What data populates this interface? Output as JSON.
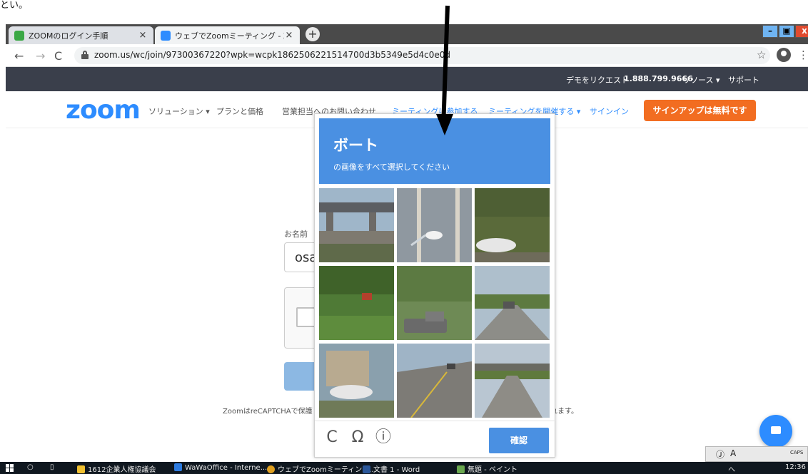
{
  "top_note": "とい。",
  "browser": {
    "tabs": [
      {
        "title": "ZOOMのログイン手順",
        "favicon_color": "#3aa845",
        "close": "×"
      },
      {
        "title": "ウェブでZoomミーティング - Zoom",
        "favicon_color": "#2d8cff",
        "close": "×"
      }
    ],
    "new_tab": "+",
    "window": {
      "minimize": "–",
      "maximize": "▣",
      "close": "x"
    },
    "nav": {
      "back": "←",
      "forward": "→",
      "reload": "C"
    },
    "url": "zoom.us/wc/join/97300367220?wpk=wcpk1862506221514700d3b5349e5d4c0e0d",
    "star": "☆",
    "menu": "⋮"
  },
  "zoom": {
    "topbar": {
      "demo": "デモをリクエスト",
      "phone": "1.888.799.9666",
      "resources": "リソース ▾",
      "support": "サポート"
    },
    "logo": "zoom",
    "nav": {
      "solutions": "ソリューション ▾",
      "plans": "プランと価格",
      "contact_sales": "営業担当へのお問い合わせ",
      "join": "ミーティングに参加する",
      "host": "ミーティングを開催する ▾",
      "signin": "サインイン",
      "signup": "サインアップは無料です"
    },
    "form": {
      "name_label": "お名前",
      "name_value": "osa",
      "recaptcha_left": "ZoomはreCAPTCHAで保護",
      "recaptcha_right": "れます。"
    }
  },
  "captcha": {
    "keyword": "ボート",
    "instruction": "の画像をすべて選択してください",
    "verify": "確認",
    "reload_icon": "C",
    "audio_icon": "Ω",
    "info_icon": "ⓘ",
    "tile_count": 9
  },
  "ime": {
    "items": [
      "Ⓙ",
      "A",
      "CAPS"
    ]
  },
  "taskbar": {
    "items": [
      {
        "label": "1612企業人権協議会",
        "color": "#f0c030"
      },
      {
        "label": "WaWaOffice - Interne...",
        "color": "#2d7be0"
      },
      {
        "label": "ウェブでZoomミーティング...",
        "color": "#e0a020"
      },
      {
        "label": "文書 1 - Word",
        "color": "#2b579a"
      },
      {
        "label": "無題 - ペイント",
        "color": "#6aa84f"
      }
    ],
    "tray": "ヘ",
    "clock": "12:36"
  }
}
